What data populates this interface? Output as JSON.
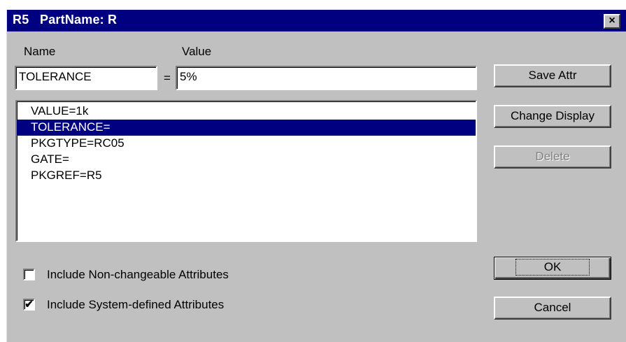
{
  "window": {
    "title": "R5   PartName: R",
    "close_glyph": "×"
  },
  "labels": {
    "name": "Name",
    "value": "Value",
    "equals": "="
  },
  "fields": {
    "name_value": "TOLERANCE",
    "value_value": "5%"
  },
  "attributes": [
    {
      "text": "VALUE=1k",
      "selected": false
    },
    {
      "text": "TOLERANCE=",
      "selected": true
    },
    {
      "text": "PKGTYPE=RC05",
      "selected": false
    },
    {
      "text": "GATE=",
      "selected": false
    },
    {
      "text": "PKGREF=R5",
      "selected": false
    }
  ],
  "buttons": {
    "save_attr": "Save Attr",
    "change_display": "Change Display",
    "delete": "Delete",
    "ok": "OK",
    "cancel": "Cancel"
  },
  "checkboxes": {
    "non_changeable": {
      "label": "Include Non-changeable Attributes",
      "checked": false
    },
    "system_defined": {
      "label": "Include System-defined Attributes",
      "checked": true
    }
  },
  "colors": {
    "titlebar": "#000080",
    "selection": "#000080",
    "face": "#c0c0c0"
  }
}
